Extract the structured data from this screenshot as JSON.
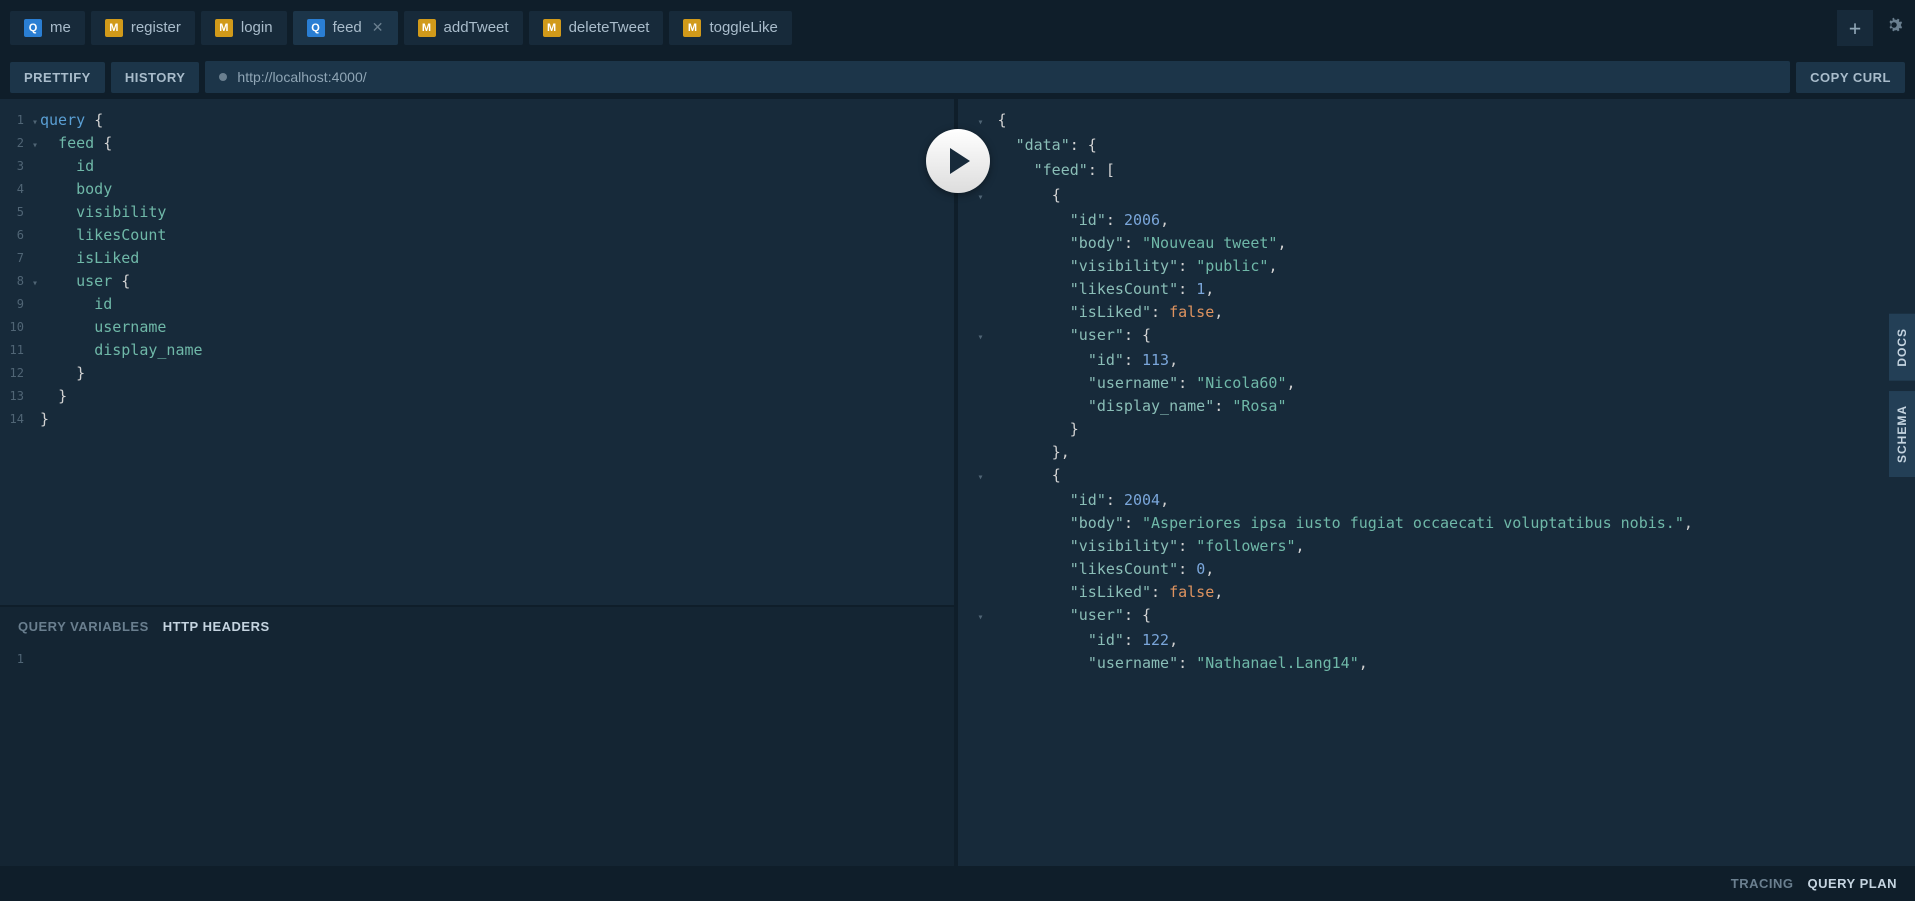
{
  "tabs": [
    {
      "type": "Q",
      "label": "me"
    },
    {
      "type": "M",
      "label": "register"
    },
    {
      "type": "M",
      "label": "login"
    },
    {
      "type": "Q",
      "label": "feed",
      "active": true,
      "closable": true
    },
    {
      "type": "M",
      "label": "addTweet"
    },
    {
      "type": "M",
      "label": "deleteTweet"
    },
    {
      "type": "M",
      "label": "toggleLike"
    }
  ],
  "toolbar": {
    "prettify": "PRETTIFY",
    "history": "HISTORY",
    "url": "http://localhost:4000/",
    "copy_curl": "COPY CURL"
  },
  "query_lines": [
    {
      "n": "1",
      "fold": true,
      "html": "<span class='kw'>query</span> <span class='punc'>{</span>"
    },
    {
      "n": "2",
      "fold": true,
      "html": "  <span class='field'>feed</span> <span class='punc'>{</span>"
    },
    {
      "n": "3",
      "html": "    <span class='field'>id</span>"
    },
    {
      "n": "4",
      "html": "    <span class='field'>body</span>"
    },
    {
      "n": "5",
      "html": "    <span class='field'>visibility</span>"
    },
    {
      "n": "6",
      "html": "    <span class='field'>likesCount</span>"
    },
    {
      "n": "7",
      "html": "    <span class='field'>isLiked</span>"
    },
    {
      "n": "8",
      "fold": true,
      "html": "    <span class='field'>user</span> <span class='punc'>{</span>"
    },
    {
      "n": "9",
      "html": "      <span class='field'>id</span>"
    },
    {
      "n": "10",
      "html": "      <span class='field'>username</span>"
    },
    {
      "n": "11",
      "html": "      <span class='field'>display_name</span>"
    },
    {
      "n": "12",
      "html": "    <span class='punc'>}</span>"
    },
    {
      "n": "13",
      "html": "  <span class='punc'>}</span>"
    },
    {
      "n": "14",
      "html": "<span class='punc'>}</span>"
    }
  ],
  "vars_tabs": {
    "query_variables": "QUERY VARIABLES",
    "http_headers": "HTTP HEADERS"
  },
  "vars_line": "1",
  "response_lines": [
    {
      "fold": true,
      "html": "<span class='punc'>{</span>"
    },
    {
      "fold": true,
      "html": "  <span class='key'>\"data\"</span><span class='punc'>: {</span>"
    },
    {
      "fold": true,
      "html": "    <span class='key'>\"feed\"</span><span class='punc'>: [</span>"
    },
    {
      "fold": true,
      "html": "      <span class='punc'>{</span>"
    },
    {
      "html": "        <span class='key'>\"id\"</span><span class='punc'>: </span><span class='num'>2006</span><span class='punc'>,</span>"
    },
    {
      "html": "        <span class='key'>\"body\"</span><span class='punc'>: </span><span class='str'>\"Nouveau tweet\"</span><span class='punc'>,</span>"
    },
    {
      "html": "        <span class='key'>\"visibility\"</span><span class='punc'>: </span><span class='str'>\"public\"</span><span class='punc'>,</span>"
    },
    {
      "html": "        <span class='key'>\"likesCount\"</span><span class='punc'>: </span><span class='num'>1</span><span class='punc'>,</span>"
    },
    {
      "html": "        <span class='key'>\"isLiked\"</span><span class='punc'>: </span><span class='bool'>false</span><span class='punc'>,</span>"
    },
    {
      "fold": true,
      "html": "        <span class='key'>\"user\"</span><span class='punc'>: {</span>"
    },
    {
      "html": "          <span class='key'>\"id\"</span><span class='punc'>: </span><span class='num'>113</span><span class='punc'>,</span>"
    },
    {
      "html": "          <span class='key'>\"username\"</span><span class='punc'>: </span><span class='str'>\"Nicola60\"</span><span class='punc'>,</span>"
    },
    {
      "html": "          <span class='key'>\"display_name\"</span><span class='punc'>: </span><span class='str'>\"Rosa\"</span>"
    },
    {
      "html": "        <span class='punc'>}</span>"
    },
    {
      "html": "      <span class='punc'>},</span>"
    },
    {
      "fold": true,
      "html": "      <span class='punc'>{</span>"
    },
    {
      "html": "        <span class='key'>\"id\"</span><span class='punc'>: </span><span class='num'>2004</span><span class='punc'>,</span>"
    },
    {
      "html": "        <span class='key'>\"body\"</span><span class='punc'>: </span><span class='str'>\"Asperiores ipsa iusto fugiat occaecati voluptatibus nobis.\"</span><span class='punc'>,</span>"
    },
    {
      "html": "        <span class='key'>\"visibility\"</span><span class='punc'>: </span><span class='str'>\"followers\"</span><span class='punc'>,</span>"
    },
    {
      "html": "        <span class='key'>\"likesCount\"</span><span class='punc'>: </span><span class='num'>0</span><span class='punc'>,</span>"
    },
    {
      "html": "        <span class='key'>\"isLiked\"</span><span class='punc'>: </span><span class='bool'>false</span><span class='punc'>,</span>"
    },
    {
      "fold": true,
      "html": "        <span class='key'>\"user\"</span><span class='punc'>: {</span>"
    },
    {
      "html": "          <span class='key'>\"id\"</span><span class='punc'>: </span><span class='num'>122</span><span class='punc'>,</span>"
    },
    {
      "html": "          <span class='key'>\"username\"</span><span class='punc'>: </span><span class='str'>\"Nathanael.Lang14\"</span><span class='punc'>,</span>"
    }
  ],
  "side_tabs": {
    "docs": "DOCS",
    "schema": "SCHEMA"
  },
  "footer": {
    "tracing": "TRACING",
    "query_plan": "QUERY PLAN"
  }
}
